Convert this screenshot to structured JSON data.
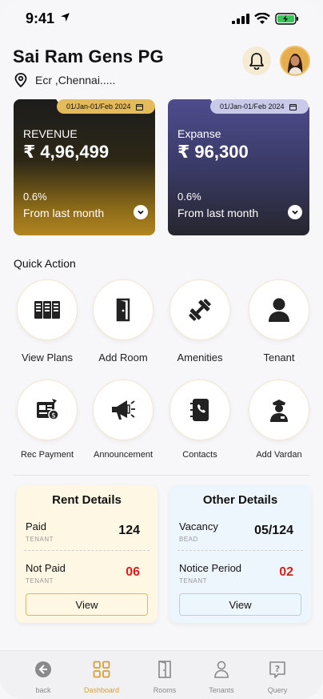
{
  "status_bar": {
    "time": "9:41"
  },
  "header": {
    "title": "Sai Ram Gens PG",
    "location": "Ecr ,Chennai....."
  },
  "cards": [
    {
      "date_range": "01/Jan-01/Feb 2024",
      "label": "REVENUE",
      "amount": "₹ 4,96,499",
      "percent": "0.6%",
      "subtitle": "From last month"
    },
    {
      "date_range": "01/Jan-01/Feb 2024",
      "label": "Expanse",
      "amount": "₹ 96,300",
      "percent": "0.6%",
      "subtitle": "From last month"
    }
  ],
  "quick_action": {
    "title": "Quick Action",
    "items": [
      {
        "label": "View Plans",
        "icon": "plans-icon"
      },
      {
        "label": "Add Room",
        "icon": "door-icon"
      },
      {
        "label": "Amenities",
        "icon": "dumbbell-icon"
      },
      {
        "label": "Tenant",
        "icon": "person-icon"
      },
      {
        "label": "Rec Payment",
        "icon": "payment-icon"
      },
      {
        "label": "Announcement",
        "icon": "megaphone-icon"
      },
      {
        "label": "Contacts",
        "icon": "contact-book-icon"
      },
      {
        "label": "Add Vardan",
        "icon": "guard-icon"
      }
    ]
  },
  "rent_details": {
    "title": "Rent Details",
    "rows": [
      {
        "label": "Paid",
        "sub": "TENANT",
        "value": "124"
      },
      {
        "label": "Not Paid",
        "sub": "TENANT",
        "value": "06"
      }
    ],
    "button": "View"
  },
  "other_details": {
    "title": "Other Details",
    "rows": [
      {
        "label": "Vacancy",
        "sub": "BEAD",
        "value": "05/124"
      },
      {
        "label": "Notice Period",
        "sub": "TENANT",
        "value": "02"
      }
    ],
    "button": "View"
  },
  "bottom_nav": [
    {
      "label": "back",
      "icon": "back-icon"
    },
    {
      "label": "Dashboard",
      "icon": "dashboard-icon",
      "active": true
    },
    {
      "label": "Rooms",
      "icon": "door-icon"
    },
    {
      "label": "Tenants",
      "icon": "person-icon"
    },
    {
      "label": "Query",
      "icon": "query-icon"
    }
  ],
  "colors": {
    "accent": "#d5a133",
    "red": "#d8201c"
  }
}
